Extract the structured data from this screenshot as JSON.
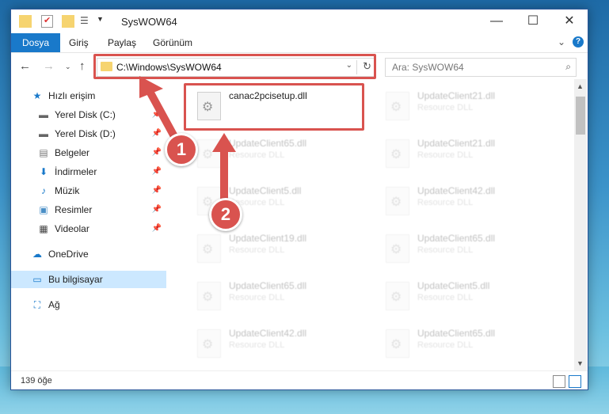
{
  "window": {
    "title": "SysWOW64"
  },
  "ribbon": {
    "tabs": [
      "Dosya",
      "Giriş",
      "Paylaş",
      "Görünüm"
    ]
  },
  "address": {
    "path": "C:\\Windows\\SysWOW64"
  },
  "search": {
    "placeholder": "Ara: SysWOW64"
  },
  "nav": {
    "quick_access": "Hızlı erişim",
    "items": [
      "Yerel Disk (C:)",
      "Yerel Disk (D:)",
      "Belgeler",
      "İndirmeler",
      "Müzik",
      "Resimler",
      "Videolar"
    ],
    "onedrive": "OneDrive",
    "this_pc": "Bu bilgisayar",
    "network": "Ağ"
  },
  "files": {
    "highlighted": {
      "name": "canac2pcisetup.dll"
    },
    "left": [
      {
        "name": "UpdateClient65.dll",
        "desc": "Resource DLL"
      },
      {
        "name": "UpdateClient5.dll",
        "desc": "Resource DLL"
      },
      {
        "name": "UpdateClient19.dll",
        "desc": "Resource DLL"
      },
      {
        "name": "UpdateClient65.dll",
        "desc": "Resource DLL"
      },
      {
        "name": "UpdateClient42.dll",
        "desc": "Resource DLL"
      }
    ],
    "right": [
      {
        "name": "UpdateClient21.dll",
        "desc": "Resource DLL"
      },
      {
        "name": "UpdateClient21.dll",
        "desc": "Resource DLL"
      },
      {
        "name": "UpdateClient42.dll",
        "desc": "Resource DLL"
      },
      {
        "name": "UpdateClient65.dll",
        "desc": "Resource DLL"
      },
      {
        "name": "UpdateClient5.dll",
        "desc": "Resource DLL"
      },
      {
        "name": "UpdateClient65.dll",
        "desc": "Resource DLL"
      }
    ]
  },
  "status": {
    "count": "139 öğe"
  },
  "annotations": {
    "step1": "1",
    "step2": "2"
  },
  "colors": {
    "accent": "#1979ca",
    "highlight": "#d9534f"
  }
}
